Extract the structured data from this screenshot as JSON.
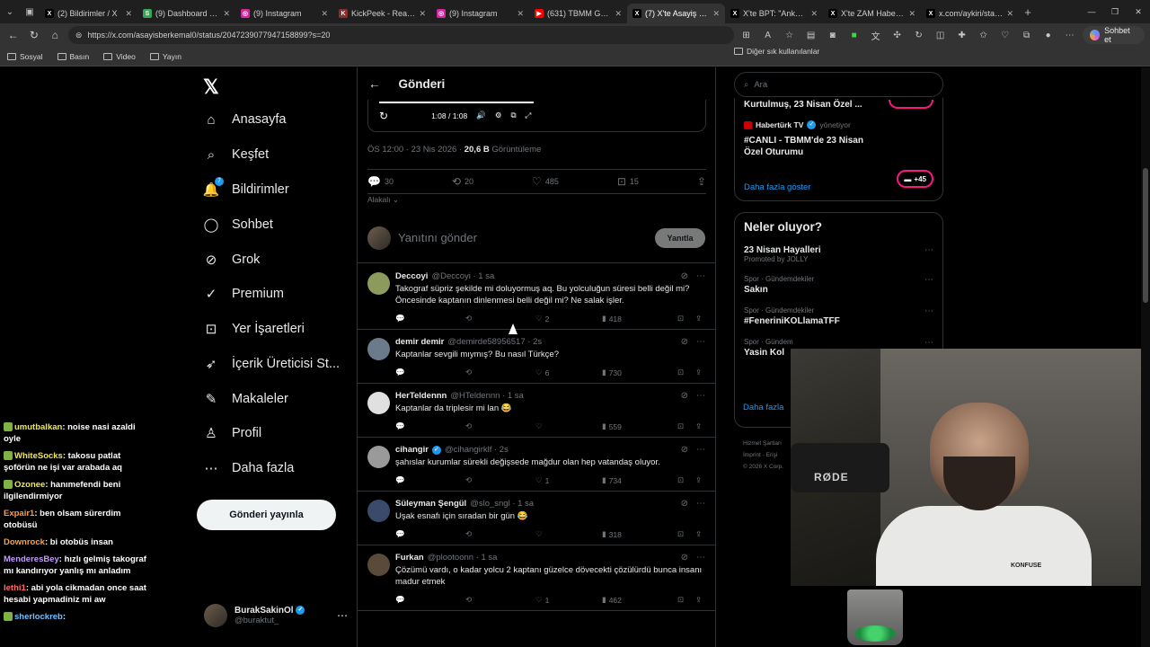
{
  "browser": {
    "tabs": [
      {
        "title": "(2) Bildirimler / X",
        "fav": "X",
        "color": "#000000"
      },
      {
        "title": "(9) Dashboard / Stre",
        "fav": "S",
        "color": "#35a853"
      },
      {
        "title": "(9) Instagram",
        "fav": "◎",
        "color": "#d6249f"
      },
      {
        "title": "KickPeek - Real-time",
        "fav": "K",
        "color": "#8b2d2d"
      },
      {
        "title": "(9) Instagram",
        "fav": "◎",
        "color": "#d6249f"
      },
      {
        "title": "(631) TBMM Genel",
        "fav": "▶",
        "color": "#ff0000"
      },
      {
        "title": "(7) X'te Asayiş Berke",
        "fav": "X",
        "color": "#000000",
        "active": true
      },
      {
        "title": "X'te BPT: \"Ankara'da",
        "fav": "X",
        "color": "#000000"
      },
      {
        "title": "X'te ZAM Haber: \"İr",
        "fav": "X",
        "color": "#000000"
      },
      {
        "title": "x.com/aykiri/status/",
        "fav": "X",
        "color": "#000000"
      }
    ],
    "url": "https://x.com/asayisberkemal0/status/2047239077947158899?s=20",
    "chat_button": "Sohbet et",
    "bookmarks": [
      "Sosyal",
      "Basın",
      "Video",
      "Yayın"
    ],
    "bookmarks_other": "Diğer sık kullanılanlar"
  },
  "nav": {
    "items": [
      {
        "label": "Anasayfa",
        "icon": "⌂"
      },
      {
        "label": "Keşfet",
        "icon": "⌕"
      },
      {
        "label": "Bildirimler",
        "icon": "🔔",
        "badge": "7"
      },
      {
        "label": "Sohbet",
        "icon": "◯"
      },
      {
        "label": "Grok",
        "icon": "⊘"
      },
      {
        "label": "Premium",
        "icon": "✓"
      },
      {
        "label": "Yer İşaretleri",
        "icon": "⊡"
      },
      {
        "label": "İçerik Üreticisi St...",
        "icon": "➶"
      },
      {
        "label": "Makaleler",
        "icon": "✎"
      },
      {
        "label": "Profil",
        "icon": "♙"
      },
      {
        "label": "Daha fazla",
        "icon": "⋯"
      }
    ],
    "post_button": "Gönderi yayınla",
    "account": {
      "name": "BurakSakinOl",
      "handle": "@buraktut_"
    }
  },
  "chat": [
    {
      "user": "umutbalkan",
      "color": "#f2e84b",
      "text": "noise nasi azaldi oyle",
      "emote": true
    },
    {
      "user": "WhiteSocks",
      "color": "#f2e84b",
      "text": "takosu patlat şoförün ne işi var arabada aq",
      "emote": true
    },
    {
      "user": "Ozonee",
      "color": "#f2e84b",
      "text": "hanımefendi beni ilgilendirmiyor",
      "emote": true
    },
    {
      "user": "Expair1",
      "color": "#ff9f43",
      "text": "ben olsam sürerdim otobüsü"
    },
    {
      "user": "Downrock",
      "color": "#ff9f43",
      "text": "bi otobüs insan"
    },
    {
      "user": "MenderesBey",
      "color": "#c39bff",
      "text": "hızlı gelmiş takograf mı kandırıyor yanlış mı anladım"
    },
    {
      "user": "Iethi1",
      "color": "#ff6b6b",
      "text": "abi yola cikmadan once saat hesabi yapmadiniz mi aw"
    },
    {
      "user": "sherlockreb",
      "color": "#6ec1ff",
      "text": "",
      "emote": true
    }
  ],
  "post": {
    "header": "Gönderi",
    "video_time": "1:08 / 1:08",
    "meta_time": "ÖS 12:00 · 23 Nis 2026 · ",
    "views": "20,6 B",
    "views_label": "Görüntüleme",
    "stats": {
      "replies": "30",
      "reposts": "20",
      "likes": "485",
      "bookmarks": "15"
    },
    "related": "Alakalı",
    "reply_placeholder": "Yanıtını gönder",
    "reply_button": "Yanıtla"
  },
  "replies": [
    {
      "name": "Deccoyi",
      "handle": "@Deccoyi · 1 sa",
      "verified": false,
      "text": "Takograf süpriz şekilde mi doluyormuş aq. Bu yolculuğun süresi belli değil mi? Öncesinde kaptanın dinlenmesi belli değil mi? Ne salak işler.",
      "likes": "2",
      "views": "418",
      "avatar": "#8c9a5b"
    },
    {
      "name": "demir demir",
      "handle": "@demirde58956517 · 2s",
      "verified": false,
      "text": "Kaptanlar sevgili mıymış? Bu nasıl Türkçe?",
      "likes": "6",
      "views": "730",
      "avatar": "#6b7b8c"
    },
    {
      "name": "HerTeldennn",
      "handle": "@HTeldennn · 1 sa",
      "verified": false,
      "text": "Kaptanlar da triplesir mi lan 😂",
      "likes": "",
      "views": "559",
      "avatar": "#e0e0e0"
    },
    {
      "name": "cihangir",
      "handle": "@cihangirklf · 2s",
      "verified": true,
      "text": "şahıslar kurumlar sürekli değişsede mağdur olan hep vatandaş oluyor.",
      "likes": "1",
      "views": "734",
      "avatar": "#9a9a9a"
    },
    {
      "name": "Süleyman Şengül",
      "handle": "@slo_sngl · 1 sa",
      "verified": false,
      "text": "Uşak esnafı için sıradan bir gün 😂",
      "likes": "",
      "views": "318",
      "avatar": "#3a4a6a"
    },
    {
      "name": "Furkan",
      "handle": "@plootoonn · 1 sa",
      "verified": false,
      "text": "Çözümü vardı, o kadar yolcu 2 kaptanı güzelce dövecekti çözülürdü bunca insanı madur etmek",
      "likes": "1",
      "views": "462",
      "avatar": "#5a4a3a"
    }
  ],
  "right": {
    "search_placeholder": "Ara",
    "live_first": "Kurtulmuş, 23 Nisan Özel ...",
    "live_source": "Habertürk TV",
    "live_role": "yönetiyor",
    "live_title": "#CANLI - TBMM'de 23 Nisan Özel Oturumu",
    "live_count": "+45",
    "show_more": "Daha fazla göster",
    "trends_title": "Neler oluyor?",
    "trends": [
      {
        "cat": "Promoted by JOLLY",
        "name": "23 Nisan Hayalleri",
        "promoted": true
      },
      {
        "cat": "Spor · Gündemdekiler",
        "name": "Sakın"
      },
      {
        "cat": "Spor · Gündemdekiler",
        "name": "#FeneriniKOLlamaTFF"
      },
      {
        "cat": "Spor · Gündem",
        "name": "Yasin Kol"
      }
    ],
    "trends_more": "Daha fazla",
    "footer": [
      "Hizmet Şartları",
      "İmprint · Erişi",
      "© 2026 X Corp."
    ]
  },
  "overlay": {
    "mic_brand": "RØDE",
    "shirt_brand": "KONFUSE"
  }
}
